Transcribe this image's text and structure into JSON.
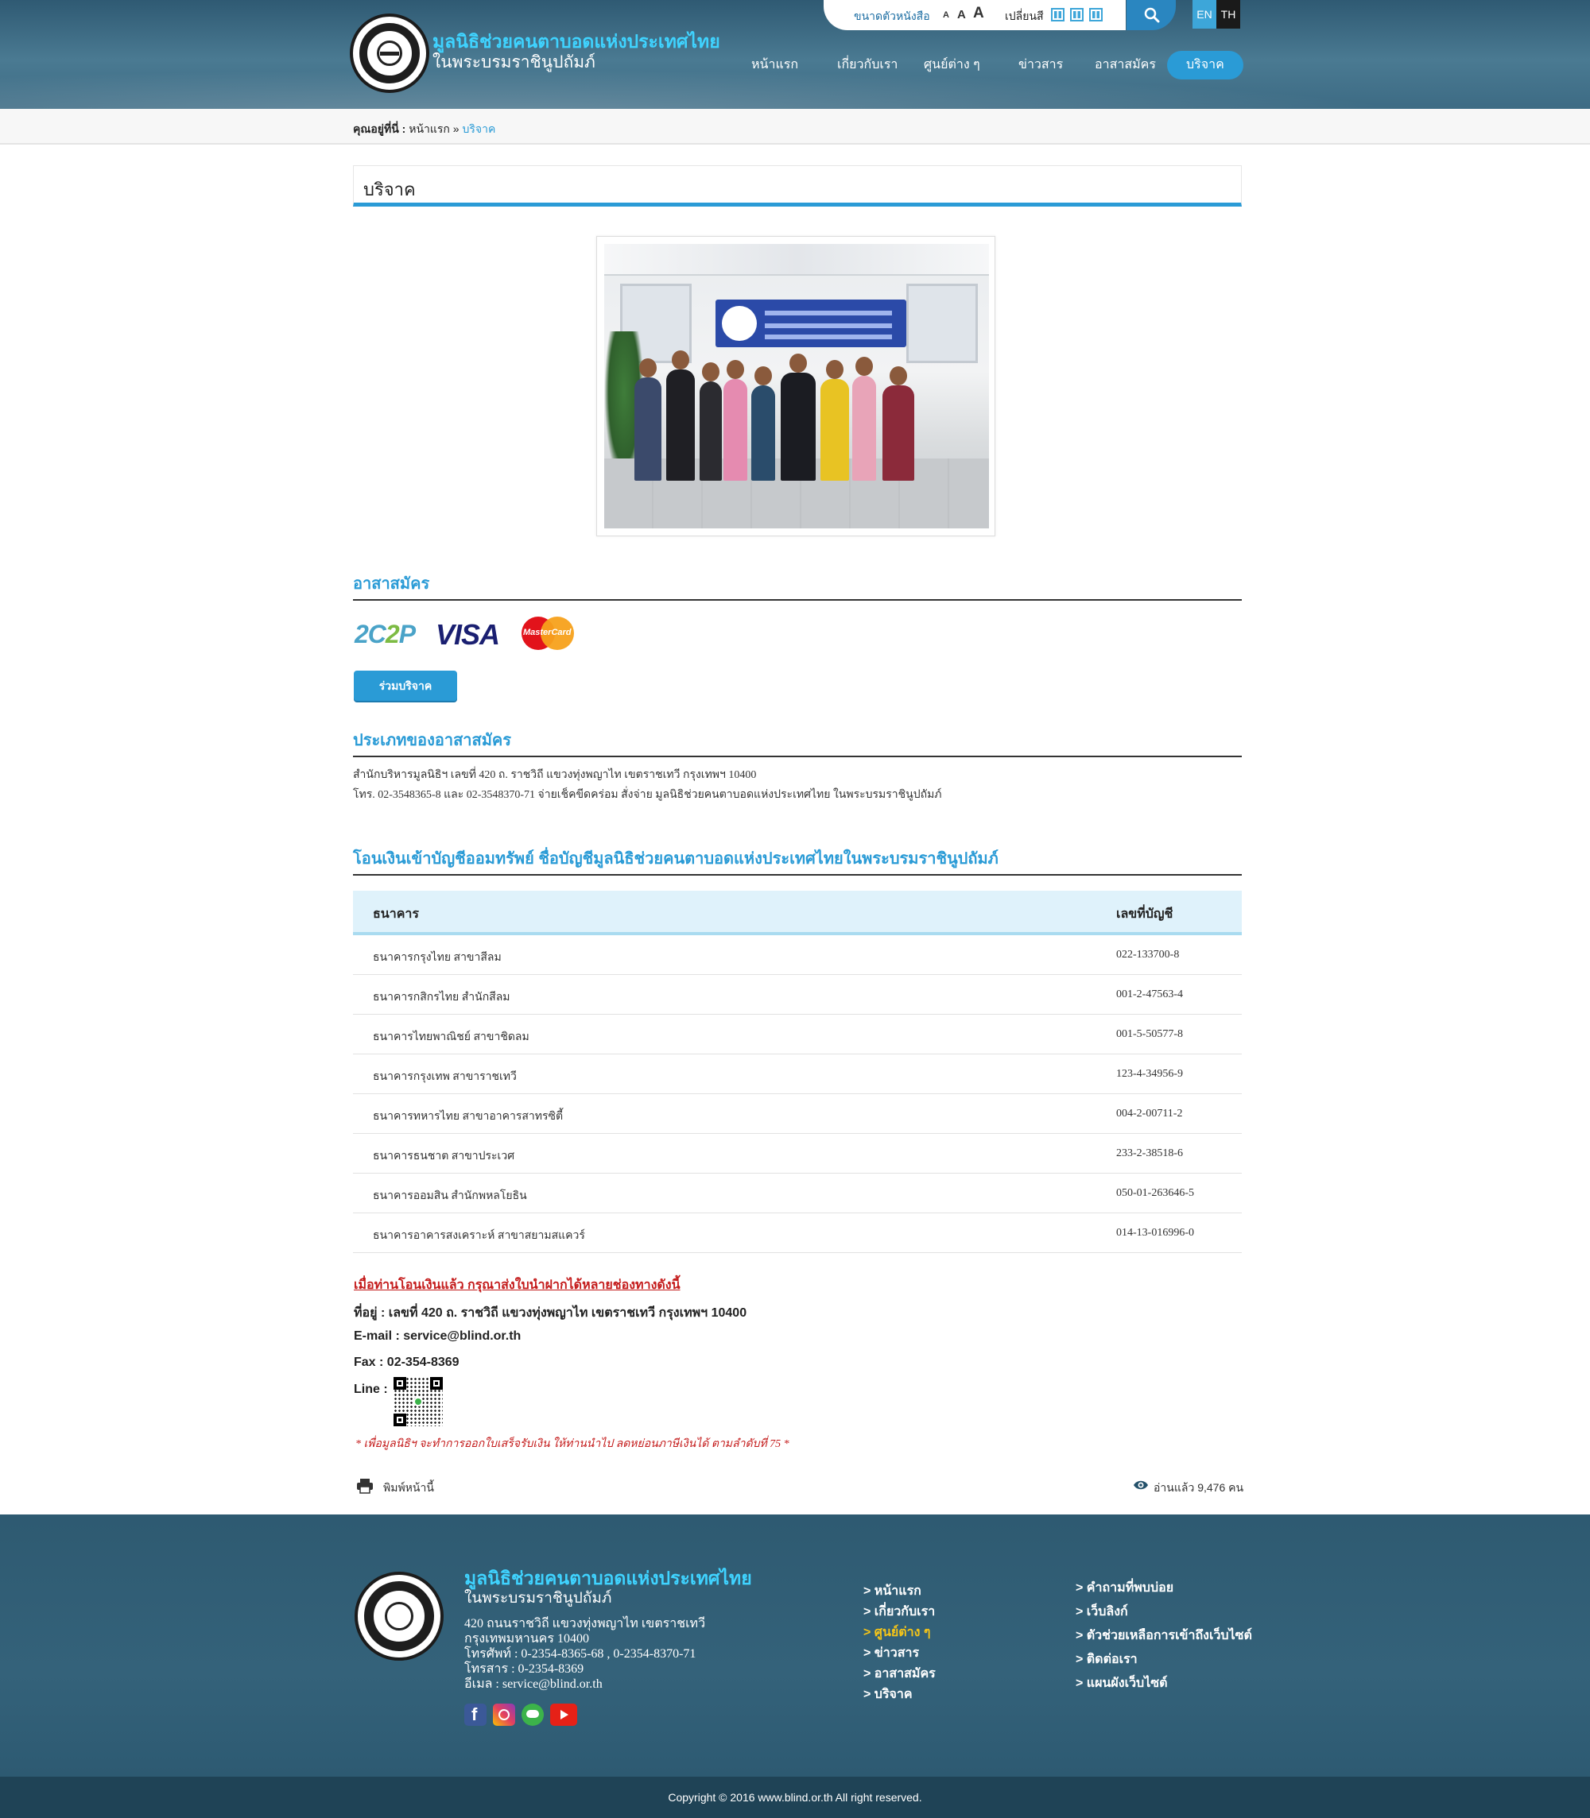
{
  "header": {
    "title_line1": "มูลนิธิช่วยคนตาบอดแห่งประเทศไทย",
    "title_line2": "ในพระบรมราชินูปถัมภ์",
    "font_size_label": "ขนาดตัวหนังสือ",
    "font_sizes": [
      "A",
      "A",
      "A"
    ],
    "change_color_label": "เปลี่ยนสี",
    "lang_en": "EN",
    "lang_th": "TH",
    "nav": [
      "หน้าแรก",
      "เกี่ยวกับเรา",
      "ศูนย์ต่าง ๆ",
      "ข่าวสาร",
      "อาสาสมัคร",
      "บริจาค"
    ],
    "nav_active": "บริจาค"
  },
  "breadcrumb": {
    "prefix": "คุณอยู่ที่นี่ :",
    "home": "หน้าแรก",
    "sep": "»",
    "current": "บริจาค"
  },
  "page": {
    "title": "บริจาค",
    "section_volunteer": "อาสาสมัคร",
    "payment_logos": [
      "2C2P",
      "VISA",
      "MasterCard"
    ],
    "donate_button": "ร่วมบริจาค",
    "section_types": "ประเภทของอาสาสมัคร",
    "types_line1": "สำนักบริหารมูลนิธิฯ เลขที่ 420 ถ. ราชวิถี แขวงทุ่งพญาไท เขตราชเทวี กรุงเทพฯ 10400",
    "types_line2": "โทร. 02-3548365-8 และ 02-3548370-71 จ่ายเช็คขีดคร่อม สั่งจ่าย มูลนิธิช่วยคนตาบอดแห่งประเทศไทย ในพระบรมราชินูปถัมภ์",
    "section_transfer": "โอนเงินเข้าบัญชีออมทรัพย์ ชื่อบัญชีมูลนิธิช่วยคนตาบอดแห่งประเทศไทยในพระบรมราชินูปถัมภ์",
    "table": {
      "col_bank": "ธนาคาร",
      "col_account": "เลขที่บัญชี",
      "rows": [
        {
          "bank": "ธนาคารกรุงไทย สาขาสีลม",
          "account": "022-133700-8"
        },
        {
          "bank": "ธนาคารกสิกรไทย สำนักสีลม",
          "account": "001-2-47563-4"
        },
        {
          "bank": "ธนาคารไทยพาณิชย์ สาขาชิดลม",
          "account": "001-5-50577-8"
        },
        {
          "bank": "ธนาคารกรุงเทพ สาขาราชเทวี",
          "account": "123-4-34956-9"
        },
        {
          "bank": "ธนาคารทหารไทย สาขาอาคารสาทรซิตี้",
          "account": "004-2-00711-2"
        },
        {
          "bank": "ธนาคารธนชาต สาขาประเวศ",
          "account": "233-2-38518-6"
        },
        {
          "bank": "ธนาคารออมสิน สำนักพหลโยธิน",
          "account": "050-01-263646-5"
        },
        {
          "bank": "ธนาคารอาคารสงเคราะห์ สาขาสยามสแควร์",
          "account": "014-13-016996-0"
        }
      ]
    },
    "notice": "เมื่อท่านโอนเงินแล้ว กรุณาส่งใบนำฝากได้หลายช่องทางดังนี้",
    "address_line": "ที่อยู่ : เลขที่ 420 ถ. ราชวิถี แขวงทุ่งพญาไท เขตราชเทวี กรุงเทพฯ 10400",
    "email_line": "E-mail : service@blind.or.th",
    "fax_line": "Fax : 02-354-8369",
    "line_label": "Line :",
    "note": "* เพื่อมูลนิธิฯ จะทำการออกใบเสร็จรับเงิน ให้ท่านนำไป ลดหย่อนภาษีเงินได้  ตามลำดับที่ 75 *",
    "print_label": "พิมพ์หน้านี้",
    "views_label": "อ่านแล้ว 9,476 คน"
  },
  "footer": {
    "title_line1": "มูลนิธิช่วยคนตาบอดแห่งประเทศไทย",
    "title_line2": "ในพระบรมราชินูปถัมภ์",
    "address": [
      "420 ถนนราชวิถี แขวงทุ่งพญาไท เขตราชเทวี",
      "กรุงเทพมหานคร 10400",
      "โทรศัพท์ : 0-2354-8365-68 , 0-2354-8370-71",
      "โทรสาร : 0-2354-8369",
      "อีเมล : service@blind.or.th"
    ],
    "links_col1": [
      "> หน้าแรก",
      "> เกี่ยวกับเรา",
      "> ศูนย์ต่าง ๆ",
      "> ข่าวสาร",
      "> อาสาสมัคร",
      "> บริจาค"
    ],
    "links_col2": [
      "> คำถามที่พบบ่อย",
      "> เว็บลิงก์",
      "> ตัวช่วยเหลือการเข้าถึงเว็บไซต์",
      "> ติดต่อเรา",
      "> แผนผังเว็บไซต์"
    ],
    "highlight_link": "> ศูนย์ต่าง ๆ",
    "copyright": "Copyright © 2016 www.blind.or.th All right reserved."
  },
  "colors": {
    "accent": "#2a9bd6",
    "header_bg": "#3d6b84",
    "footer_bg": "#34627a",
    "warning_red": "#c41b1b",
    "link_highlight": "#f5c518"
  },
  "icons": [
    "search-icon",
    "print-icon",
    "eye-icon",
    "facebook-icon",
    "instagram-icon",
    "line-icon",
    "youtube-icon"
  ]
}
